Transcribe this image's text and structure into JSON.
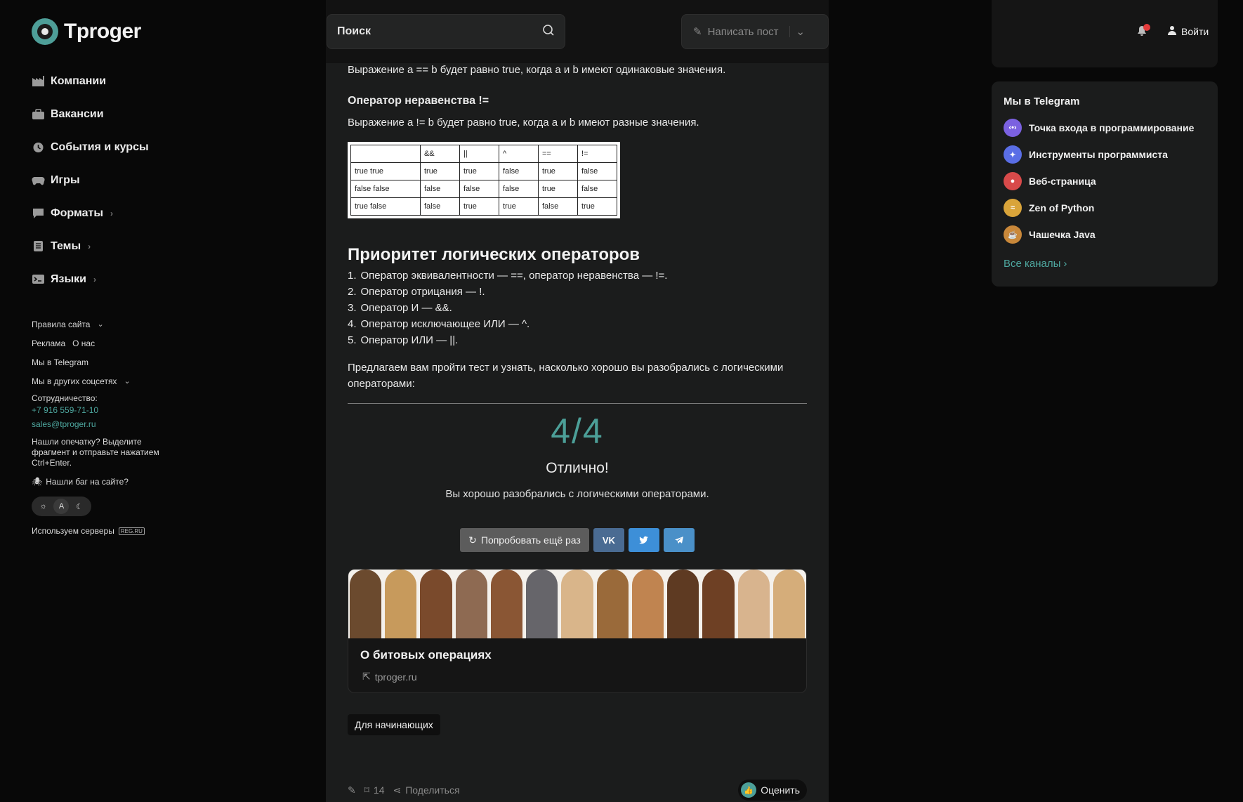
{
  "brand": {
    "name": "Tproger"
  },
  "nav": [
    {
      "label": "Компании",
      "icon": "factory-icon",
      "chevron": ""
    },
    {
      "label": "Вакансии",
      "icon": "briefcase-icon",
      "chevron": ""
    },
    {
      "label": "События и курсы",
      "icon": "clock-icon",
      "chevron": ""
    },
    {
      "label": "Игры",
      "icon": "gamepad-icon",
      "chevron": ""
    },
    {
      "label": "Форматы",
      "icon": "chat-icon",
      "chevron": "›"
    },
    {
      "label": "Темы",
      "icon": "book-icon",
      "chevron": "›"
    },
    {
      "label": "Языки",
      "icon": "terminal-icon",
      "chevron": "›"
    }
  ],
  "footer": {
    "rules": "Правила сайта",
    "ads": "Реклама",
    "about": "О нас",
    "telegram": "Мы в Telegram",
    "social": "Мы в других соцсетях",
    "coop_label": "Сотрудничество:",
    "phone": "+7 916 559-71-10",
    "email": "sales@tproger.ru",
    "typo_note": "Нашли опечатку? Выделите фрагмент и отправьте нажатием Ctrl+Enter.",
    "bug": "Нашли баг на сайте?",
    "theme_auto": "A",
    "servers": "Используем серверы",
    "servers_badge": "REG.RU"
  },
  "topbar": {
    "search_placeholder": "Поиск",
    "write_post": "Написать пост",
    "login": "Войти"
  },
  "article": {
    "eq_text": "Выражение a == b будет равно true, когда a и b имеют одинаковые значения.",
    "neq_heading": "Оператор неравенства !=",
    "neq_text": "Выражение a != b будет равно true, когда a и b имеют разные значения.",
    "table": {
      "header": [
        "",
        "&&",
        "||",
        "^",
        "==",
        "!="
      ],
      "rows": [
        [
          "true true",
          "true",
          "true",
          "false",
          "true",
          "false"
        ],
        [
          "false false",
          "false",
          "false",
          "false",
          "true",
          "false"
        ],
        [
          "true false",
          "false",
          "true",
          "true",
          "false",
          "true"
        ]
      ]
    },
    "priority_heading": "Приоритет логических операторов",
    "priority_list": [
      "Оператор эквивалентности — ==, оператор неравенства — !=.",
      "Оператор отрицания — !.",
      "Оператор И — &&.",
      "Оператор исключающее ИЛИ — ^.",
      "Оператор ИЛИ — ||."
    ],
    "quiz_intro": "Предлагаем вам пройти тест и узнать, насколько хорошо вы разобрались с логическими операторами:"
  },
  "quiz": {
    "score": "4/4",
    "title": "Отлично!",
    "text": "Вы хорошо разобрались с логическими операторами.",
    "retry": "Попробовать ещё раз",
    "vk": "VK"
  },
  "link_card": {
    "title": "О битовых операциях",
    "domain": "tproger.ru"
  },
  "tag": "Для начинающих",
  "actions": {
    "bookmarks": "14",
    "share": "Поделиться",
    "rate": "Оценить"
  },
  "telegram_widget": {
    "title": "Мы в Telegram",
    "channels": [
      {
        "name": "Точка входа в программирование",
        "color": "#7b61e0"
      },
      {
        "name": "Инструменты программиста",
        "color": "#5a6ee6"
      },
      {
        "name": "Веб-страница",
        "color": "#d84a4a"
      },
      {
        "name": "Zen of Python",
        "color": "#d9a43a"
      },
      {
        "name": "Чашечка Java",
        "color": "#c9883a"
      }
    ],
    "all": "Все каналы"
  },
  "colors": {
    "accent": "#4c9f98",
    "background": "#080808",
    "panel": "#1b1c1c"
  }
}
